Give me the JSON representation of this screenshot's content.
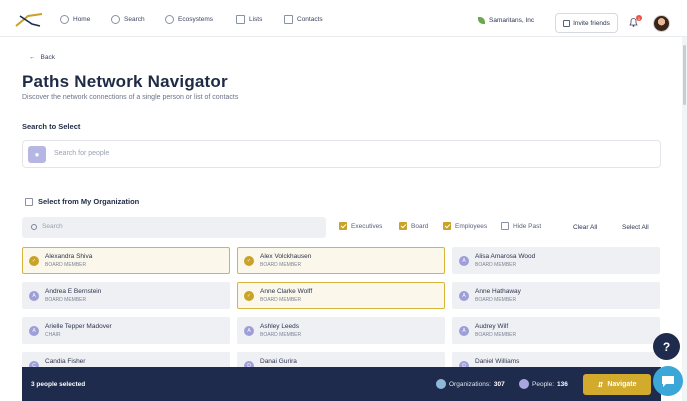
{
  "nav": {
    "items": [
      {
        "label": "Home",
        "icon": "home-icon"
      },
      {
        "label": "Search",
        "icon": "search-icon"
      },
      {
        "label": "Ecosystems",
        "icon": "ecosystems-icon"
      },
      {
        "label": "Lists",
        "icon": "lists-icon"
      },
      {
        "label": "Contacts",
        "icon": "contacts-icon"
      }
    ],
    "org_name": "Samaritans, Inc",
    "invite_label": "Invite friends",
    "notification_count": "1"
  },
  "page": {
    "back_label": "Back",
    "title": "Paths Network Navigator",
    "subtitle": "Discover the network connections of a single person or list of contacts",
    "search_section_label": "Search to Select",
    "people_search_placeholder": "Search for people",
    "org_select_label": "Select from My Organization",
    "filter_search_placeholder": "Search"
  },
  "filters": [
    {
      "label": "Executives",
      "checked": true
    },
    {
      "label": "Board",
      "checked": true
    },
    {
      "label": "Employees",
      "checked": true
    },
    {
      "label": "Hide Past",
      "checked": false
    }
  ],
  "actions": {
    "clear_all": "Clear All",
    "select_all": "Select All"
  },
  "people": [
    {
      "initial": "A",
      "name": "Alexandra Shiva",
      "role": "BOARD MEMBER",
      "selected": true
    },
    {
      "initial": "A",
      "name": "Alex Volckhausen",
      "role": "BOARD MEMBER",
      "selected": true
    },
    {
      "initial": "A",
      "name": "Alisa Amarosa Wood",
      "role": "BOARD MEMBER",
      "selected": false
    },
    {
      "initial": "A",
      "name": "Andrea E Bernstein",
      "role": "BOARD MEMBER",
      "selected": false
    },
    {
      "initial": "A",
      "name": "Anne Clarke Wolff",
      "role": "BOARD MEMBER",
      "selected": true
    },
    {
      "initial": "A",
      "name": "Anne Hathaway",
      "role": "BOARD MEMBER",
      "selected": false
    },
    {
      "initial": "A",
      "name": "Arielle Tepper Madover",
      "role": "CHAIR",
      "selected": false
    },
    {
      "initial": "A",
      "name": "Ashley Leeds",
      "role": "BOARD MEMBER",
      "selected": false
    },
    {
      "initial": "A",
      "name": "Audrey Wilf",
      "role": "BOARD MEMBER",
      "selected": false
    },
    {
      "initial": "C",
      "name": "Candia Fisher",
      "role": "",
      "selected": false
    },
    {
      "initial": "D",
      "name": "Danai Gurira",
      "role": "",
      "selected": false
    },
    {
      "initial": "D",
      "name": "Daniel Williams",
      "role": "",
      "selected": false
    }
  ],
  "bottom": {
    "selected_text": "3 people selected",
    "organizations_label": "Organizations:",
    "organizations_count": "307",
    "people_label": "People:",
    "people_count": "136",
    "navigate_label": "Navigate"
  },
  "fabs": {
    "help": "?"
  },
  "colors": {
    "accent_gold": "#d2aa2c",
    "navy": "#1f2b4d",
    "avatar_purple": "#9e9ed8"
  }
}
